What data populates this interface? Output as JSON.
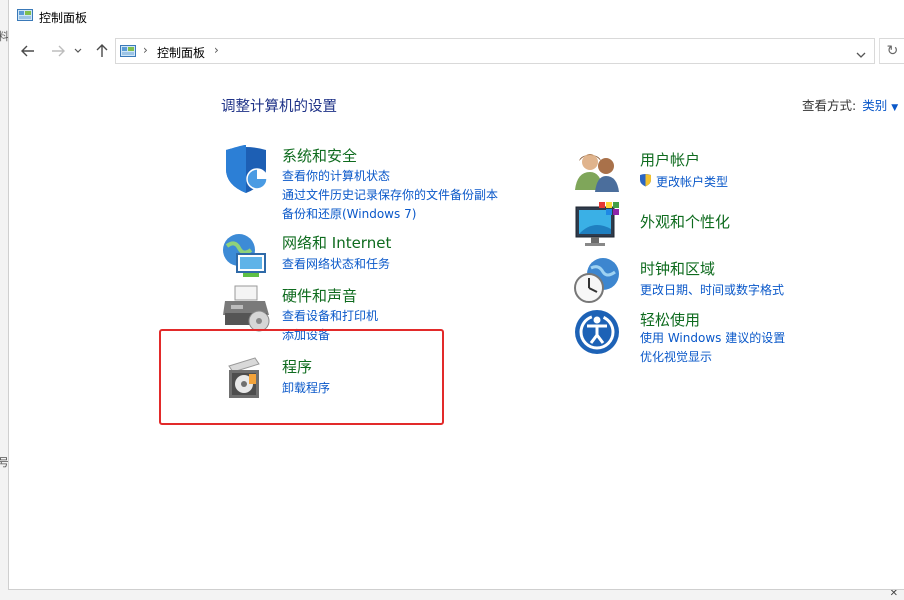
{
  "window": {
    "title": "控制面板"
  },
  "address": {
    "breadcrumb": "控制面板",
    "separator": "›"
  },
  "content": {
    "heading": "调整计算机的设置",
    "view_by_label": "查看方式:",
    "view_by_value": "类别"
  },
  "categories": {
    "system_security": {
      "title": "系统和安全",
      "links": [
        "查看你的计算机状态",
        "通过文件历史记录保存你的文件备份副本",
        "备份和还原(Windows 7)"
      ]
    },
    "network": {
      "title": "网络和 Internet",
      "links": [
        "查看网络状态和任务"
      ]
    },
    "hardware": {
      "title": "硬件和声音",
      "links": [
        "查看设备和打印机",
        "添加设备"
      ]
    },
    "programs": {
      "title": "程序",
      "links": [
        "卸载程序"
      ]
    },
    "user_accounts": {
      "title": "用户帐户",
      "links": [
        "更改帐户类型"
      ]
    },
    "appearance": {
      "title": "外观和个性化",
      "links": []
    },
    "clock_region": {
      "title": "时钟和区域",
      "links": [
        "更改日期、时间或数字格式"
      ]
    },
    "ease_access": {
      "title": "轻松使用",
      "links": [
        "使用 Windows 建议的设置",
        "优化视觉显示"
      ]
    }
  },
  "background": {
    "left_glyphs": [
      "料",
      "号"
    ]
  },
  "colors": {
    "title_green": "#0e6b1e",
    "link_blue": "#0a58c9",
    "heading_navy": "#1e3287",
    "highlight_red": "#e22a2a"
  },
  "icons": [
    "control-panel-icon",
    "back-arrow-icon",
    "forward-arrow-icon",
    "recent-chevron-icon",
    "up-arrow-icon",
    "refresh-icon",
    "shield-icon",
    "globe-network-icon",
    "printer-icon",
    "programs-disc-icon",
    "users-icon",
    "uac-shield-icon",
    "monitor-palette-icon",
    "clock-globe-icon",
    "ease-of-access-icon"
  ]
}
